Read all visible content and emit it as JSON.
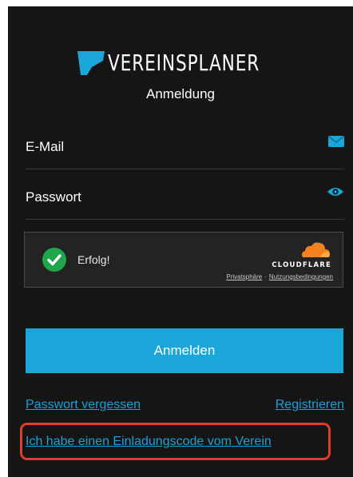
{
  "brand": {
    "name": "VEREINSPLANER",
    "accent_color": "#1aa6d9"
  },
  "page": {
    "subtitle": "Anmeldung"
  },
  "form": {
    "email_label": "E-Mail",
    "email_icon": "envelope-icon",
    "password_label": "Passwort",
    "password_icon": "eye-icon"
  },
  "captcha": {
    "status": "Erfolg!",
    "provider": "CLOUDFLARE",
    "privacy_link": "Privatsphäre",
    "separator": "·",
    "terms_link": "Nutzungsbedingungen"
  },
  "actions": {
    "login_label": "Anmelden",
    "forgot_password": "Passwort vergessen",
    "register": "Registrieren",
    "invite_code": "Ich habe einen Einladungscode vom Verein"
  },
  "annotation": {
    "highlight_color": "#e33a2a"
  }
}
